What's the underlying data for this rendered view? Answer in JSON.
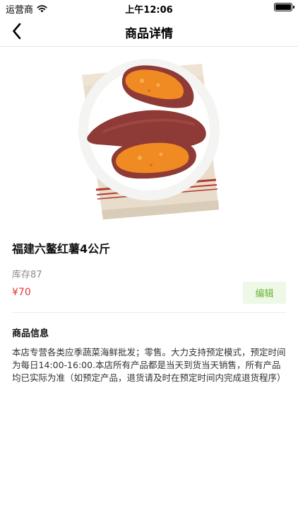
{
  "status_bar": {
    "carrier": "运营商",
    "time": "上午12:06",
    "wifi_icon": "wifi-icon",
    "battery_icon": "battery-icon"
  },
  "nav": {
    "title": "商品详情",
    "back_icon": "chevron-left-icon"
  },
  "product": {
    "image": "sweet-potato-on-plate",
    "name": "福建六鳌红薯4公斤",
    "stock_label": "库存",
    "stock_value": "87",
    "price": "¥70",
    "edit_label": "编辑"
  },
  "info": {
    "heading": "商品信息",
    "body": "本店专营各类应季蔬菜海鲜批发；零售。大力支持预定模式，预定时间为每日14:00-16:00.本店所有产品都是当天到货当天销售，所有产品均已实际为准（如预定产品，退货请及时在预定时间内完成退货程序）"
  },
  "colors": {
    "price": "#e63a2f",
    "edit_text": "#6bb33a",
    "edit_bg": "#eef8e6",
    "stock_text": "#8a8a8a"
  }
}
